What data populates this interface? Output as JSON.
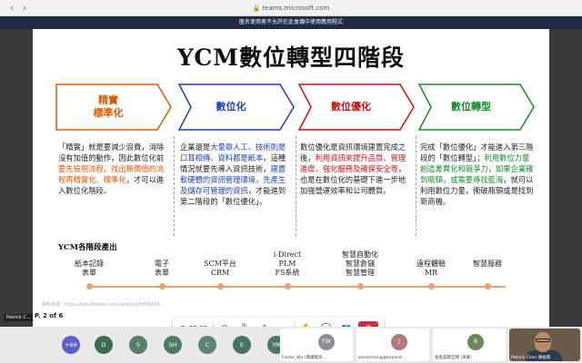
{
  "browser": {
    "url": "teams.microsoft.com",
    "back_icon": "‹",
    "forward_icon": "›"
  },
  "banner": {
    "text": "匿名使用者不允許在此會議中使用應用程式"
  },
  "slide": {
    "title": "YCM數位轉型四階段",
    "stages": [
      {
        "line1": "精實",
        "line2": "標準化",
        "color": "#e05a00"
      },
      {
        "line1": "數位化",
        "line2": "",
        "color": "#1b3fbf"
      },
      {
        "line1": "數位優化",
        "line2": "",
        "color": "#d01010"
      },
      {
        "line1": "數位轉型",
        "line2": "",
        "color": "#138a2e"
      }
    ],
    "desc1": [
      {
        "t": "「精實」就是要減少浪費，消除沒有加值的動作，因此數位化前",
        "c": ""
      },
      {
        "t": "要先檢視流程，找出無價值的流程再精實化、標準化",
        "c": "hl-orange"
      },
      {
        "t": "，才可以進入數位化階段。",
        "c": ""
      }
    ],
    "desc2": [
      {
        "t": "企業還是",
        "c": ""
      },
      {
        "t": "大量靠人工、技術則是口耳相傳、資料都是紙本",
        "c": "hl-blue"
      },
      {
        "t": "，這種情況就要先導入資訊技術，",
        "c": ""
      },
      {
        "t": "建置軟硬體的資訊管理環境，先產生及儲存可管理的資訊",
        "c": "hl-blue"
      },
      {
        "t": "，才能進到第二階段的「數位優化」。",
        "c": ""
      }
    ],
    "desc3": [
      {
        "t": "數位優化是資訊環境建置完成之後，",
        "c": ""
      },
      {
        "t": "利用資訊來提升品質、管理進度、強化服務及確保安全等",
        "c": "hl-red"
      },
      {
        "t": "，也是在數位化的基礎下進一步地加強營運效率和公司體質。",
        "c": ""
      }
    ],
    "desc4": [
      {
        "t": "完成「數位優化」才能進入第三階段的「數位轉型」；",
        "c": ""
      },
      {
        "t": "利用數位力量創造差異化和競爭力，如果企業確到瓶頸，或需要尋找藍海",
        "c": "hl-green"
      },
      {
        "t": "，就可以利用數位力量，衝破瓶頸或是找到新商機。",
        "c": ""
      }
    ],
    "timeline_title": "YCM各階段產出",
    "timeline_items": [
      {
        "top": "紙本記錄",
        "bottom": "表單"
      },
      {
        "top": "電子",
        "bottom": "表單"
      },
      {
        "top": "SCM平台",
        "bottom": "CRM"
      },
      {
        "top": "i-Direct",
        "mid": "PLM",
        "bottom": "FS系統"
      },
      {
        "top": "智慧自動化",
        "mid": "智慧倉儲",
        "bottom": "智慧管理"
      },
      {
        "top": "遠程體驗",
        "bottom": "MR"
      },
      {
        "top": "",
        "bottom": "智慧服務"
      }
    ],
    "reference": "資料來源：https://adv.ithome.com.tw/story/0850450..."
  },
  "presenter": "Patrick C...",
  "page_indicator": "P. 2 of 6",
  "controls": {
    "timer": "22:09",
    "icons": [
      "camera-off-icon",
      "mic-off-icon",
      "share-icon",
      "more-icon",
      "raise-hand-icon",
      "chat-icon",
      "people-icon"
    ],
    "hangup": "✆"
  },
  "participants": {
    "overflow": "+66",
    "avatars": [
      {
        "initials": "D",
        "color": "#3e6b4f"
      },
      {
        "initials": "S",
        "color": "#567f6a"
      },
      {
        "initials": "SH",
        "color": "#4f7a63"
      },
      {
        "initials": "C",
        "color": "#5a8570"
      },
      {
        "initials": "E",
        "color": "#477560"
      },
      {
        "initials": "YM",
        "color": "#4c7863"
      }
    ],
    "tiles": [
      {
        "initials": "FW",
        "name": "Foster_Wu (閱讀資訊...",
        "color": "#8a8f95"
      },
      {
        "initials": "J",
        "name": "jessiechang@beyond...",
        "color": "#b07a7a"
      },
      {
        "initials": "B",
        "name": "金金茲錦互睹 (來賓)",
        "color": "#6a8a5a"
      }
    ],
    "video_name": "Patrick Chen 陳柏霖"
  }
}
